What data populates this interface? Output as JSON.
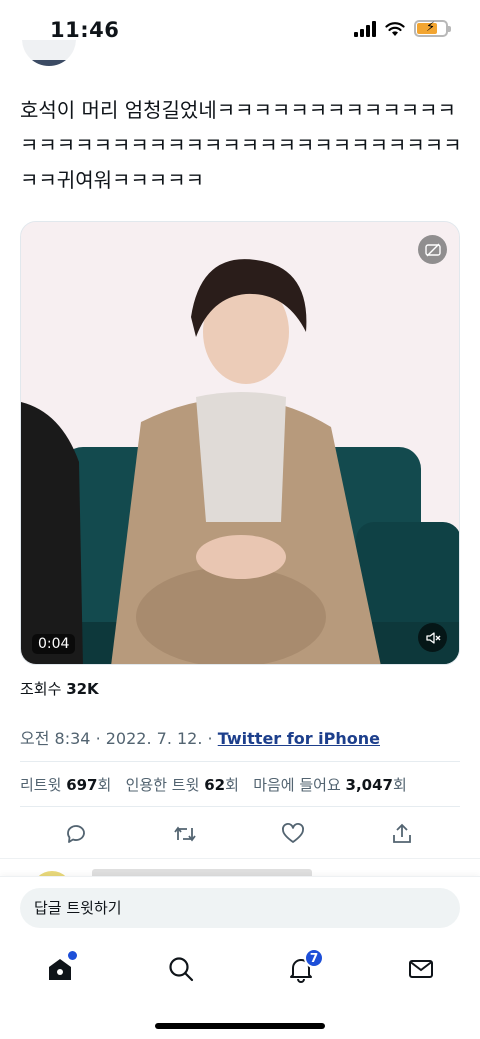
{
  "status_bar": {
    "time": "11:46"
  },
  "tweet": {
    "text": "호석이 머리 엄청길었네ㅋㅋㅋㅋㅋㅋㅋㅋㅋㅋㅋㅋㅋㅋㅋㅋㅋㅋㅋㅋㅋㅋㅋㅋㅋㅋㅋㅋㅋㅋㅋㅋㅋㅋㅋㅋㅋㅋㅋ귀여워ㅋㅋㅋㅋㅋ",
    "media": {
      "duration": "0:04"
    },
    "views_label": "조회수",
    "views_value": "32K",
    "time": "오전 8:34",
    "date": "2022. 7. 12.",
    "separator": "·",
    "source": "Twitter for iPhone",
    "stats": {
      "retweets_label": "리트윗",
      "retweets_value": "697",
      "retweets_unit": "회",
      "quotes_label": "인용한 트윗",
      "quotes_value": "62",
      "quotes_unit": "회",
      "likes_label": "마음에 들어요",
      "likes_value": "3,047",
      "likes_unit": "회"
    }
  },
  "actions": [
    "reply-icon",
    "retweet-icon",
    "like-icon",
    "share-icon"
  ],
  "reply_box": {
    "placeholder": "답글 트윗하기"
  },
  "tab_bar": {
    "notifications_badge": "7"
  },
  "colors": {
    "link": "#1d3f8c",
    "accent": "#1d4fd8",
    "battery": "#f2a531"
  }
}
